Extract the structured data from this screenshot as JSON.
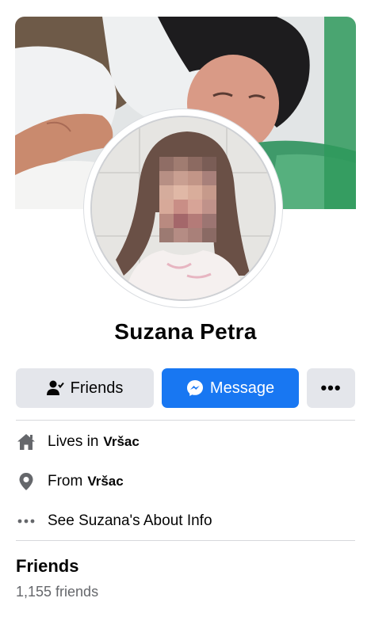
{
  "profile": {
    "name": "Suzana  Petra"
  },
  "actions": {
    "friends_label": "Friends",
    "message_label": "Message",
    "more_label": "•••"
  },
  "intro": {
    "lives_in_prefix": "Lives in",
    "lives_in_place": "Vršac",
    "from_prefix": "From",
    "from_place": "Vršac",
    "about_link": "See Suzana's About Info"
  },
  "friends_section": {
    "title": "Friends",
    "count": "1,155 friends"
  },
  "colors": {
    "primary": "#1877f2",
    "button_gray": "#e4e6eb",
    "secondary_text": "#65676b"
  }
}
